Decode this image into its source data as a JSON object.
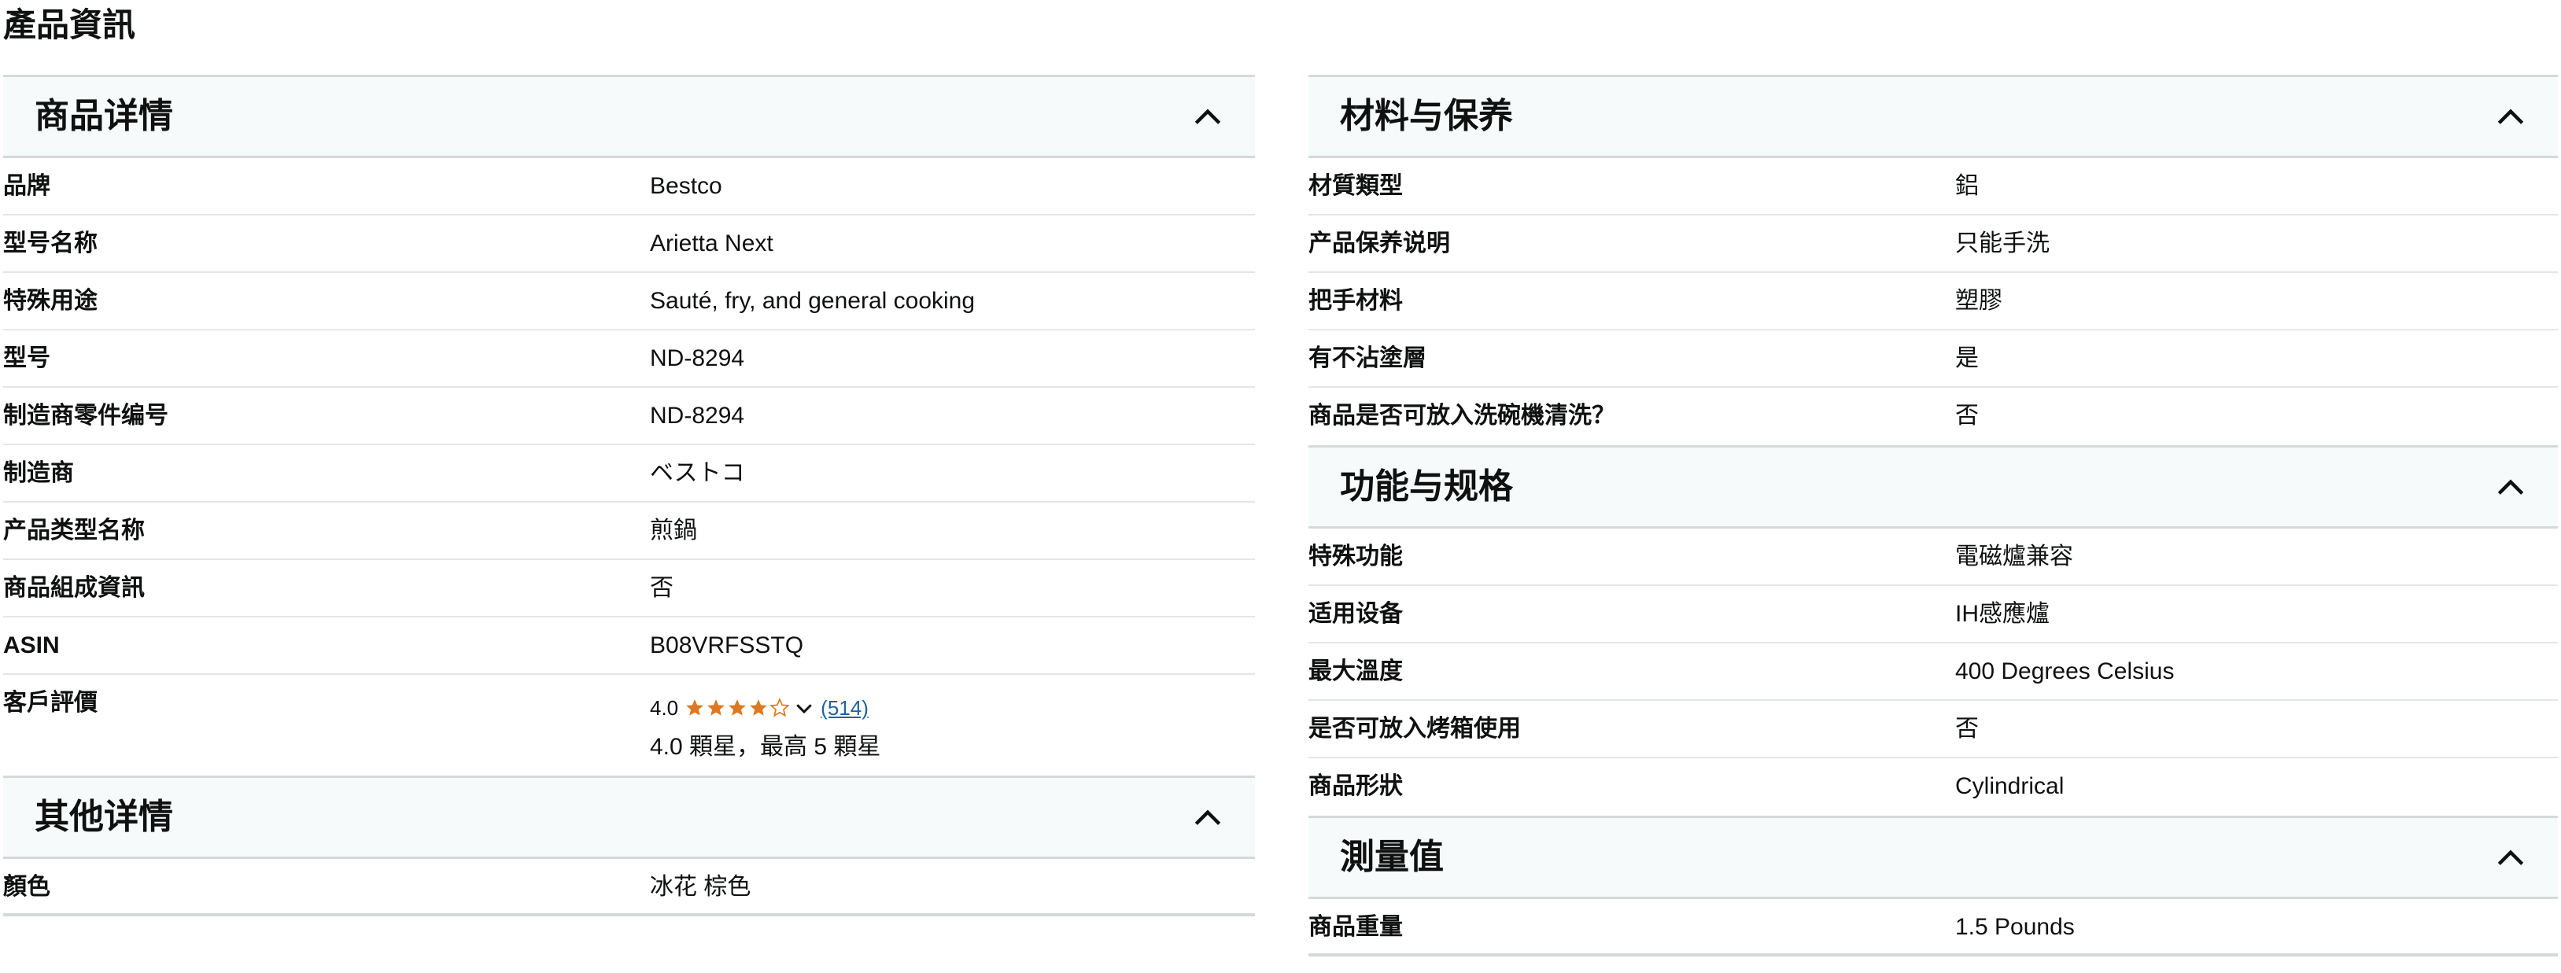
{
  "page_title": "產品資訊",
  "left_column": {
    "details": {
      "title": "商品详情",
      "rows": [
        {
          "label": "品牌",
          "value": "Bestco"
        },
        {
          "label": "型号名称",
          "value": "Arietta Next"
        },
        {
          "label": "特殊用途",
          "value": "Sauté, fry, and general cooking"
        },
        {
          "label": "型号",
          "value": "ND-8294"
        },
        {
          "label": "制造商零件编号",
          "value": "ND-8294"
        },
        {
          "label": "制造商",
          "value": "ベストコ"
        },
        {
          "label": "产品类型名称",
          "value": "煎鍋"
        },
        {
          "label": "商品組成資訊",
          "value": "否"
        },
        {
          "label": "ASIN",
          "value": "B08VRFSSTQ"
        }
      ],
      "rating": {
        "label": "客戶評價",
        "score": "4.0",
        "stars_value": 4.0,
        "count_link": "(514)",
        "summary": "4.0 顆星，最高 5 顆星"
      }
    },
    "other": {
      "title": "其他详情",
      "rows": [
        {
          "label": "顏色",
          "value": "冰花 棕色"
        }
      ]
    }
  },
  "right_column": {
    "materials": {
      "title": "材料与保养",
      "rows": [
        {
          "label": "材質類型",
          "value": "鋁"
        },
        {
          "label": "产品保养说明",
          "value": "只能手洗"
        },
        {
          "label": "把手材料",
          "value": "塑膠"
        },
        {
          "label": "有不沾塗層",
          "value": "是"
        },
        {
          "label": "商品是否可放入洗碗機清洗？",
          "value": "否"
        }
      ]
    },
    "features": {
      "title": "功能与规格",
      "rows": [
        {
          "label": "特殊功能",
          "value": "電磁爐兼容"
        },
        {
          "label": "适用设备",
          "value": "IH感應爐"
        },
        {
          "label": "最大溫度",
          "value": "400 Degrees Celsius"
        },
        {
          "label": "是否可放入烤箱使用",
          "value": "否"
        },
        {
          "label": "商品形狀",
          "value": "Cylindrical"
        }
      ]
    },
    "measurements": {
      "title": "測量值",
      "rows": [
        {
          "label": "商品重量",
          "value": "1.5 Pounds"
        }
      ]
    }
  },
  "colors": {
    "star": "#de7921",
    "link": "#2162a1",
    "header_bg": "#f7fafa",
    "border": "#d5d9d9"
  }
}
